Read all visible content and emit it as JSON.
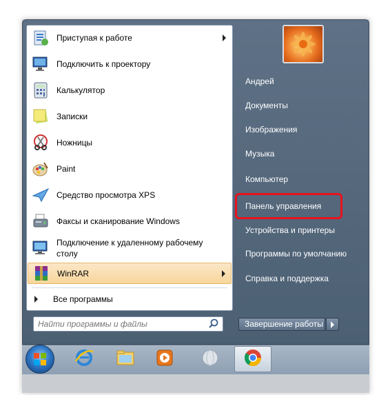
{
  "programs": [
    {
      "label": "Приступая к работе",
      "icon": "getting-started-icon",
      "submenu": true
    },
    {
      "label": "Подключить к проектору",
      "icon": "projector-icon",
      "submenu": false
    },
    {
      "label": "Калькулятор",
      "icon": "calculator-icon",
      "submenu": false
    },
    {
      "label": "Записки",
      "icon": "sticky-notes-icon",
      "submenu": false
    },
    {
      "label": "Ножницы",
      "icon": "scissors-icon",
      "submenu": false
    },
    {
      "label": "Paint",
      "icon": "paint-palette-icon",
      "submenu": false
    },
    {
      "label": "Средство просмотра XPS",
      "icon": "xps-viewer-icon",
      "submenu": false
    },
    {
      "label": "Факсы и сканирование Windows",
      "icon": "fax-scanner-icon",
      "submenu": false
    },
    {
      "label_line1": "Подключение к удаленному рабочему",
      "label_line2": "столу",
      "icon": "remote-desktop-icon",
      "submenu": false
    },
    {
      "label": "WinRAR",
      "icon": "winrar-icon",
      "submenu": true,
      "highlighted": true
    }
  ],
  "all_programs": "Все программы",
  "search": {
    "placeholder": "Найти программы и файлы",
    "value": ""
  },
  "right_items": [
    "Андрей",
    "Документы",
    "Изображения",
    "Музыка",
    "Компьютер",
    "Панель управления",
    "Устройства и принтеры",
    "Программы по умолчанию",
    "Справка и поддержка"
  ],
  "shutdown_label": "Завершение работы",
  "taskbar": [
    "start-orb",
    "internet-explorer-icon",
    "file-explorer-icon",
    "media-player-icon",
    "globe-icon",
    "chrome-icon"
  ],
  "highlight_color": "#e8121c"
}
